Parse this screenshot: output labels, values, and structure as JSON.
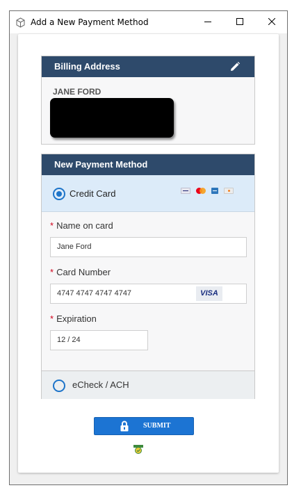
{
  "window": {
    "title": "Add a New Payment Method",
    "controls": [
      "minimize-icon",
      "maximize-icon",
      "close-icon"
    ]
  },
  "billing": {
    "header": "Billing Address",
    "edit_icon": "pencil-icon",
    "name": "JANE FORD"
  },
  "payment": {
    "header": "New Payment Method",
    "credit_card": {
      "label": "Credit Card",
      "selected": true,
      "card_brands": [
        "visa",
        "mastercard",
        "amex",
        "discover"
      ]
    },
    "fields": {
      "name_label": "Name on card",
      "name_value": "Jane Ford",
      "number_label": "Card Number",
      "number_value": "4747 4747 4747 4747",
      "number_brand": "VISA",
      "expiration_label": "Expiration",
      "expiration_value": "12 / 24",
      "required_marker": "*"
    },
    "echeck": {
      "label": "eCheck / ACH",
      "selected": false
    }
  },
  "submit": {
    "label": "SUBMIT",
    "icon": "lock-icon"
  },
  "colors": {
    "header_bg": "#2e4a6b",
    "accent": "#1c74d3",
    "selected_bg": "#dcebf9",
    "required": "#d0021b"
  }
}
